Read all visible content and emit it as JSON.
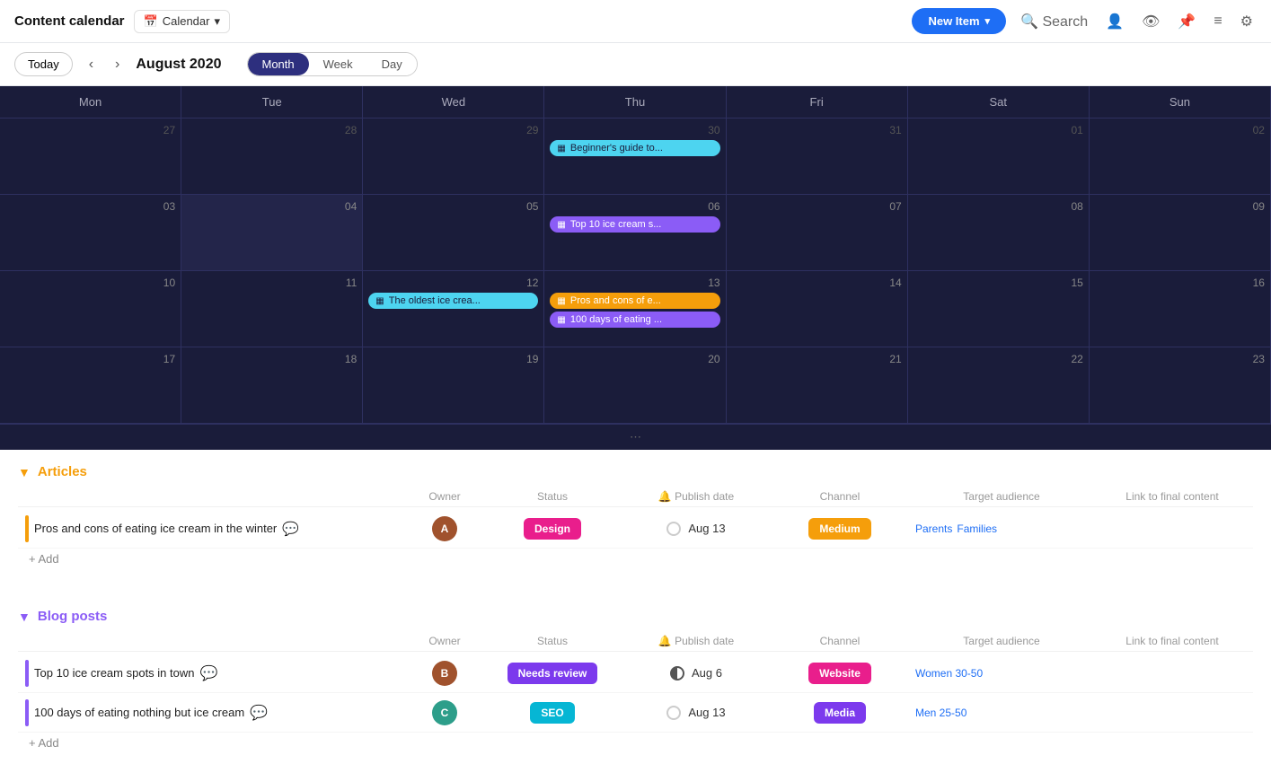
{
  "app": {
    "title": "Content calendar",
    "view_selector": "Calendar",
    "new_item_label": "New Item",
    "search_label": "Search"
  },
  "toolbar": {
    "today_label": "Today",
    "month_label": "August 2020",
    "views": [
      "Month",
      "Week",
      "Day"
    ],
    "active_view": "Month"
  },
  "calendar": {
    "days": [
      "Mon",
      "Tue",
      "Wed",
      "Thu",
      "Fri",
      "Sat",
      "Sun"
    ],
    "weeks": [
      {
        "cells": [
          {
            "date": "27",
            "dimmed": true,
            "events": []
          },
          {
            "date": "28",
            "dimmed": true,
            "events": []
          },
          {
            "date": "29",
            "dimmed": true,
            "events": []
          },
          {
            "date": "30",
            "dimmed": true,
            "events": [
              {
                "label": "Beginner's guide to...",
                "color": "cyan"
              }
            ]
          },
          {
            "date": "31",
            "dimmed": true,
            "events": []
          },
          {
            "date": "01",
            "dimmed": true,
            "events": []
          },
          {
            "date": "02",
            "dimmed": true,
            "events": []
          }
        ]
      },
      {
        "cells": [
          {
            "date": "03",
            "dimmed": false,
            "events": []
          },
          {
            "date": "04",
            "dimmed": false,
            "today": true,
            "events": []
          },
          {
            "date": "05",
            "dimmed": false,
            "events": []
          },
          {
            "date": "06",
            "dimmed": false,
            "events": [
              {
                "label": "Top 10 ice cream s...",
                "color": "purple"
              }
            ]
          },
          {
            "date": "07",
            "dimmed": false,
            "events": []
          },
          {
            "date": "08",
            "dimmed": false,
            "events": []
          },
          {
            "date": "09",
            "dimmed": false,
            "events": []
          }
        ]
      },
      {
        "cells": [
          {
            "date": "10",
            "dimmed": false,
            "events": []
          },
          {
            "date": "11",
            "dimmed": false,
            "events": []
          },
          {
            "date": "12",
            "dimmed": false,
            "events": [
              {
                "label": "The oldest ice crea...",
                "color": "cyan"
              }
            ]
          },
          {
            "date": "13",
            "dimmed": false,
            "events": [
              {
                "label": "Pros and cons of e...",
                "color": "orange"
              },
              {
                "label": "100 days of eating ...",
                "color": "purple"
              }
            ]
          },
          {
            "date": "14",
            "dimmed": false,
            "events": []
          },
          {
            "date": "15",
            "dimmed": false,
            "events": []
          },
          {
            "date": "16",
            "dimmed": false,
            "events": []
          }
        ]
      },
      {
        "cells": [
          {
            "date": "17",
            "dimmed": false,
            "events": []
          },
          {
            "date": "18",
            "dimmed": false,
            "events": []
          },
          {
            "date": "19",
            "dimmed": false,
            "events": []
          },
          {
            "date": "20",
            "dimmed": false,
            "events": []
          },
          {
            "date": "21",
            "dimmed": false,
            "events": []
          },
          {
            "date": "22",
            "dimmed": false,
            "events": []
          },
          {
            "date": "23",
            "dimmed": false,
            "events": []
          }
        ]
      }
    ]
  },
  "articles_section": {
    "title": "Articles",
    "columns": [
      "",
      "Owner",
      "Status",
      "Publish date",
      "Channel",
      "Target audience",
      "Link to final content"
    ],
    "rows": [
      {
        "title": "Pros and cons of eating ice cream in the winter",
        "owner_initials": "A",
        "owner_color": "brown",
        "status": "Design",
        "status_color": "pink",
        "publish_date": "Aug 13",
        "channel": "Medium",
        "channel_color": "yellow",
        "tags": [
          "Parents",
          "Families"
        ]
      }
    ],
    "add_label": "+ Add"
  },
  "blog_posts_section": {
    "title": "Blog posts",
    "columns": [
      "",
      "Owner",
      "Status",
      "Publish date",
      "Channel",
      "Target audience",
      "Link to final content"
    ],
    "rows": [
      {
        "title": "Top 10 ice cream spots in town",
        "owner_initials": "B",
        "owner_color": "brown",
        "status": "Needs review",
        "status_color": "purple",
        "publish_date": "Aug 6",
        "circle": "half",
        "channel": "Website",
        "channel_color": "pink",
        "tags": [
          "Women 30-50"
        ]
      },
      {
        "title": "100 days of eating nothing but ice cream",
        "owner_initials": "C",
        "owner_color": "teal",
        "status": "SEO",
        "status_color": "cyan",
        "publish_date": "Aug 13",
        "circle": "empty",
        "channel": "Media",
        "channel_color": "purple-ch",
        "tags": [
          "Men 25-50"
        ]
      }
    ],
    "add_label": "+ Add"
  }
}
